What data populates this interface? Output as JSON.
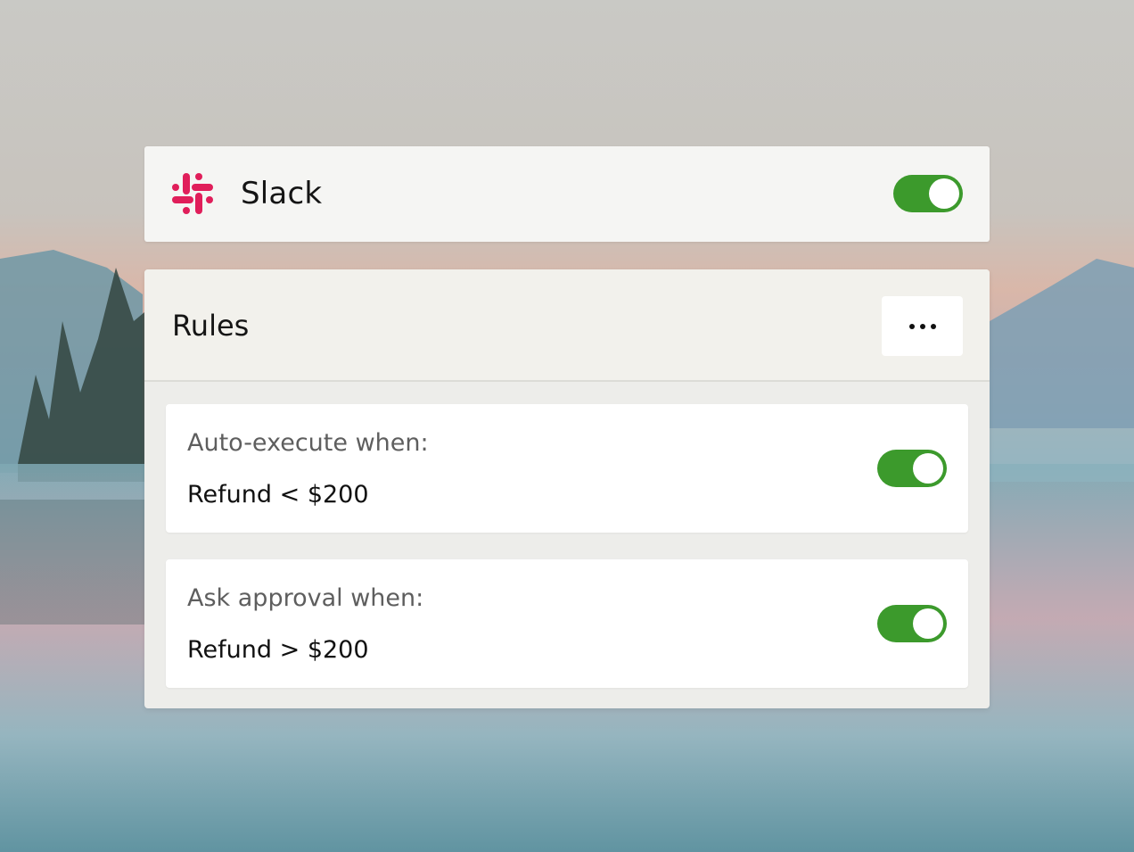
{
  "app": {
    "name": "Slack",
    "icon": "slack-logo-icon",
    "enabled": true
  },
  "rules": {
    "title": "Rules",
    "more_icon": "more-horizontal-icon",
    "items": [
      {
        "label": "Auto-execute when:",
        "value": "Refund < $200",
        "enabled": true
      },
      {
        "label": "Ask approval when:",
        "value": "Refund > $200",
        "enabled": true
      }
    ]
  },
  "colors": {
    "toggle_on": "#3c9a2c",
    "slack_logo": "#e01e5a"
  }
}
